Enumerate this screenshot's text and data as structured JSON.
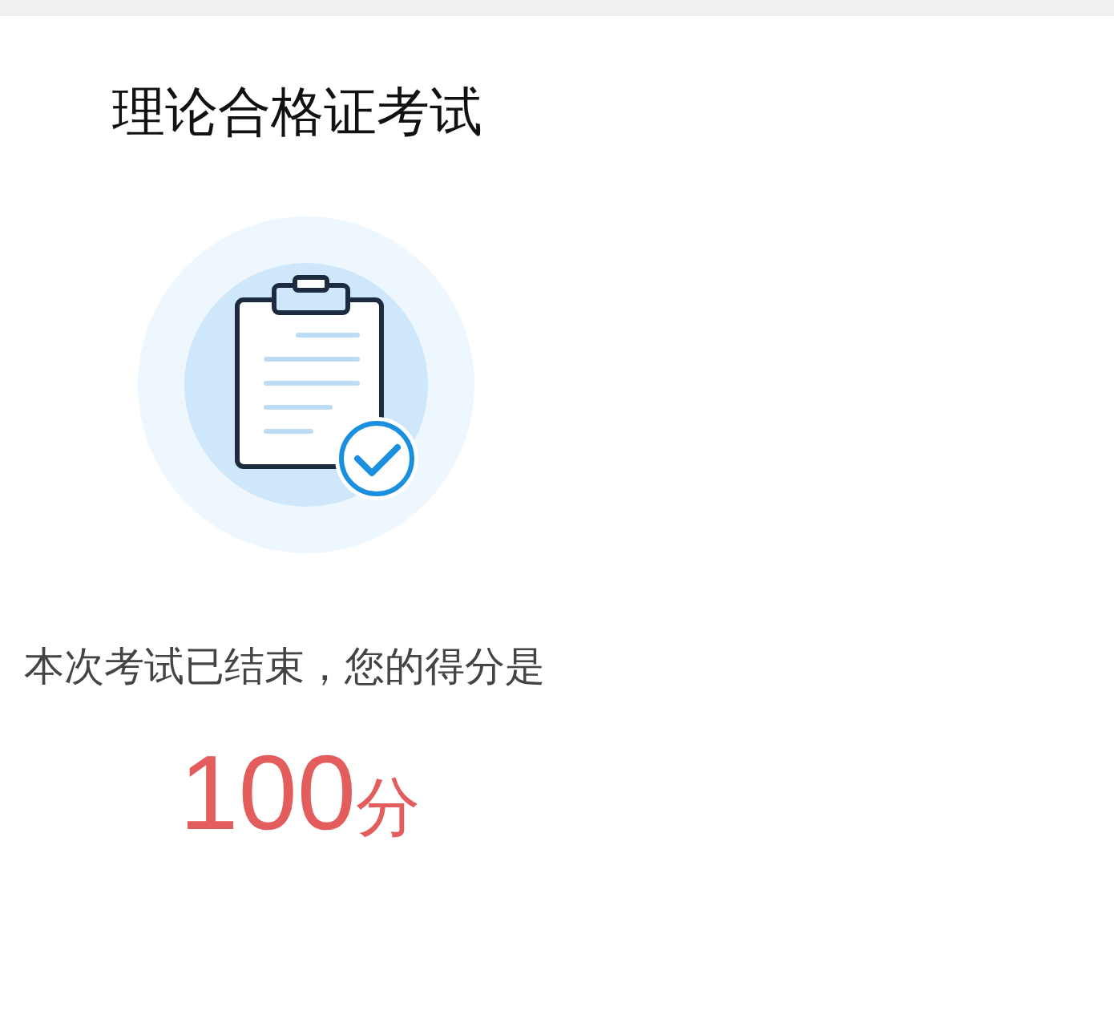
{
  "title": "理论合格证考试",
  "message": "本次考试已结束，您的得分是",
  "score": {
    "value": "100",
    "unit": "分"
  }
}
